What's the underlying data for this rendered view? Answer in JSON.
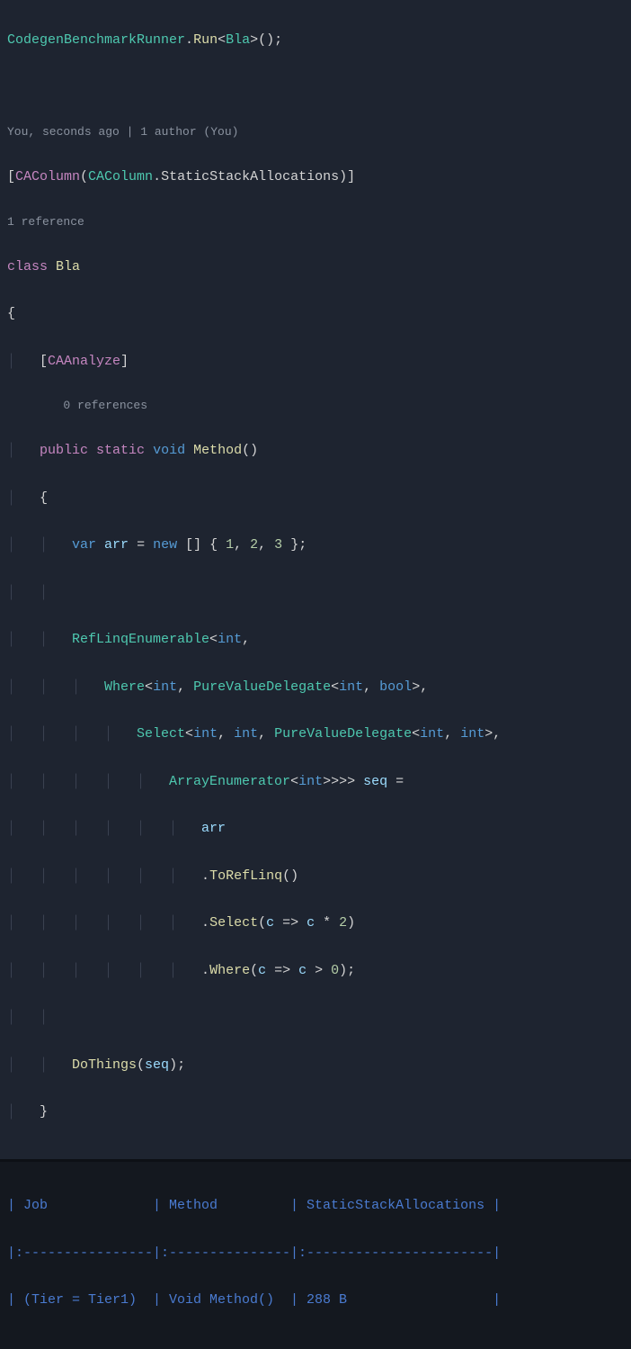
{
  "editor": {
    "line1": {
      "type1": "CodegenBenchmarkRunner",
      "dot": ".",
      "method": "Run",
      "br1": "<",
      "type2": "Bla",
      "br2": ">",
      "parens": "();"
    },
    "codelens1": "You, seconds ago | 1 author (You)",
    "attrOpen": "[",
    "attrName1": "CAColumn",
    "attrParen1": "(",
    "attrType": "CAColumn",
    "attrDot": ".",
    "attrMember": "StaticStackAllocations",
    "attrParen2": ")",
    "attrClose": "]",
    "codelens2": "1 reference",
    "kwClass": "class",
    "className": "Bla",
    "braceOpen": "{",
    "attr2Open": "    [",
    "attr2Name": "CAAnalyze",
    "attr2Close": "]",
    "codelens3": "    0 references",
    "kwPublic": "public",
    "kwStatic": "static",
    "kwVoid": "void",
    "methodName": "Method",
    "methodParens": "()",
    "braceOpen2": "    {",
    "kwVar": "var",
    "varArr": "arr",
    "eq": " = ",
    "kwNew": "new",
    "arrOpen": " [] { ",
    "n1": "1",
    "c1": ", ",
    "n2": "2",
    "c2": ", ",
    "n3": "3",
    "arrClose": " };",
    "tRefLinq": "RefLinqEnumerable",
    "lt1": "<",
    "tInt1": "int",
    "comma1": ",",
    "tWhere": "Where",
    "lt2": "<",
    "tInt2": "int",
    "comma2": ", ",
    "tPVD1": "PureValueDelegate",
    "lt3": "<",
    "tInt3": "int",
    "comma3": ", ",
    "tBool": "bool",
    "gt1": ">",
    "comma4": ",",
    "tSelect": "Select",
    "lt4": "<",
    "tInt4": "int",
    "comma5": ", ",
    "tInt5": "int",
    "comma6": ", ",
    "tPVD2": "PureValueDelegate",
    "lt5": "<",
    "tInt6": "int",
    "comma7": ", ",
    "tInt7": "int",
    "gt2": ">",
    "comma8": ",",
    "tArrEnum": "ArrayEnumerator",
    "lt6": "<",
    "tInt8": "int",
    "gt3": ">>>>",
    "varSeq": "seq",
    "eqSeq": " =",
    "arr2": "arr",
    "dot1": ".",
    "mToRef": "ToRefLinq",
    "parens1": "()",
    "dot2": ".",
    "mSelect": "Select",
    "pOpen1": "(",
    "pC1": "c",
    "arrow1": " => ",
    "pC2": "c",
    "mul": " * ",
    "n4": "2",
    "pClose1": ")",
    "dot3": ".",
    "mWhere": "Where",
    "pOpen2": "(",
    "pC3": "c",
    "arrow2": " => ",
    "pC4": "c",
    "gt": " > ",
    "n5": "0",
    "pClose2": ");",
    "mDoThings": "DoThings",
    "pOpen3": "(",
    "pSeq": "seq",
    "pClose3": ");",
    "braceClose2": "    }",
    "braceClose1": "}"
  },
  "table": {
    "row1": "| Job             | Method         | StaticStackAllocations |",
    "row2": "|:----------------|:---------------|:-----------------------|",
    "row3": "| (Tier = Tier1)  | Void Method()  | 288 B                  |"
  },
  "chart_data": {
    "type": "table",
    "columns": [
      "Job",
      "Method",
      "StaticStackAllocations"
    ],
    "rows": [
      {
        "Job": "(Tier = Tier1)",
        "Method": "Void Method()",
        "StaticStackAllocations": "288 B"
      }
    ]
  }
}
